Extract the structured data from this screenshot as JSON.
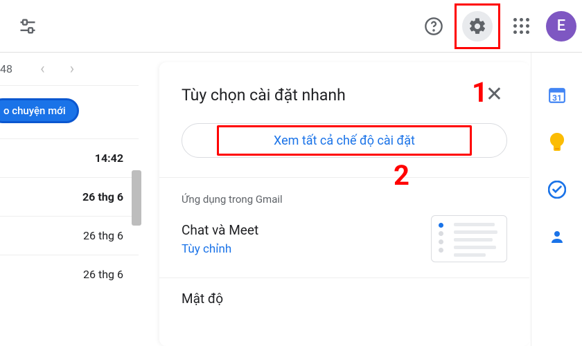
{
  "header": {
    "avatar_initial": "E"
  },
  "inbox": {
    "visible_count": "48",
    "chip_label": "o chuyện mới",
    "rows": [
      {
        "time": "14:42",
        "bold": true
      },
      {
        "time": "26 thg 6",
        "bold": true
      },
      {
        "time": "26 thg 6",
        "bold": false
      },
      {
        "time": "26 thg 6",
        "bold": false
      }
    ]
  },
  "panel": {
    "title": "Tùy chọn cài đặt nhanh",
    "see_all": "Xem tất cả chế độ cài đặt",
    "section_apps": "Ứng dụng trong Gmail",
    "chat_line1": "Chat và Meet",
    "chat_line2": "Tùy chỉnh",
    "density": "Mật độ",
    "markers": {
      "one": "1",
      "two": "2"
    }
  }
}
